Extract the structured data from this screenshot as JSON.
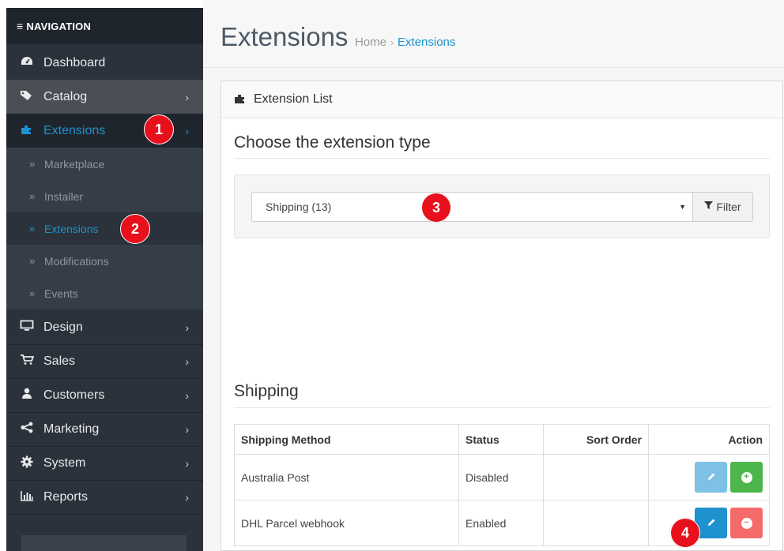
{
  "sidebar": {
    "header": "NAVIGATION",
    "items": [
      {
        "label": "Dashboard",
        "icon": "dashboard-icon"
      },
      {
        "label": "Catalog",
        "icon": "tags-icon"
      },
      {
        "label": "Extensions",
        "icon": "puzzle-icon"
      },
      {
        "label": "Design",
        "icon": "monitor-icon"
      },
      {
        "label": "Sales",
        "icon": "cart-icon"
      },
      {
        "label": "Customers",
        "icon": "user-icon"
      },
      {
        "label": "Marketing",
        "icon": "share-icon"
      },
      {
        "label": "System",
        "icon": "gear-icon"
      },
      {
        "label": "Reports",
        "icon": "bar-chart-icon"
      }
    ],
    "submenu": [
      {
        "label": "Marketplace"
      },
      {
        "label": "Installer"
      },
      {
        "label": "Extensions"
      },
      {
        "label": "Modifications"
      },
      {
        "label": "Events"
      }
    ]
  },
  "badges": {
    "b1": "1",
    "b2": "2",
    "b3": "3",
    "b4": "4"
  },
  "header": {
    "title": "Extensions",
    "breadcrumb": [
      {
        "label": "Home"
      },
      {
        "label": "Extensions"
      }
    ]
  },
  "panel": {
    "title": "Extension List",
    "choose_heading": "Choose the extension type",
    "select_value": "Shipping (13)",
    "filter_label": "Filter",
    "section_heading": "Shipping"
  },
  "table": {
    "columns": [
      "Shipping Method",
      "Status",
      "Sort Order",
      "Action"
    ],
    "rows": [
      {
        "method": "Australia Post",
        "status": "Disabled",
        "sort": ""
      },
      {
        "method": "DHL Parcel webhook",
        "status": "Enabled",
        "sort": ""
      }
    ]
  },
  "colors": {
    "sidebar_bg": "#2b323b",
    "active_link": "#1e91cf",
    "badge_red": "#e8101c",
    "install_green": "#4cb64c",
    "uninstall_red": "#f56b6b"
  }
}
